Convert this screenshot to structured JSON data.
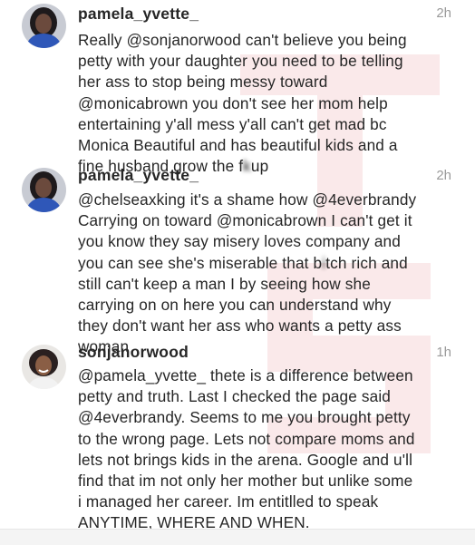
{
  "colors": {
    "text": "#262626",
    "timestamp": "#9a9a9a",
    "watermark": "#d8303a"
  },
  "watermark": {
    "text": "TSR"
  },
  "comments": [
    {
      "username": "pamela_yvette_",
      "time": "2h",
      "avatar": "avatar-photo-woman-blue-top",
      "lines": [
        "Really @sonjanorwood can't believe you being",
        "petty with your daughter you need to be telling",
        "her ass to stop being messy toward",
        "@monicabrown you don't see her mom help",
        "entertaining y'all mess y'all can't get mad bc",
        "Monica Beautiful and has beautiful kids and a",
        "fine husband grow the f",
        "k",
        "up"
      ]
    },
    {
      "username": "pamela_yvette_",
      "time": "2h",
      "avatar": "avatar-photo-woman-blue-top",
      "lines": [
        "@chelseaxking it's a shame how @4everbrandy",
        "Carrying on toward @monicabrown I can't get it",
        "you know they say misery loves company and",
        "you can see she's miserable that b",
        "tch rich and",
        "still can't keep a man I by seeing how she",
        "carrying on on here you can understand why",
        "they don't want her ass who wants a petty ass",
        "woman"
      ]
    },
    {
      "username": "sonjanorwood",
      "time": "1h",
      "avatar": "avatar-photo-woman-smiling",
      "lines": [
        "@pamela_yvette_ thete is a difference between",
        "petty and truth. Last I checked the page said",
        "@4everbrandy. Seems to me you brought petty",
        "to the wrong page. Lets not compare moms and",
        "lets not brings kids in the arena. Google and u'll",
        "find that im not only her mother but unlike some",
        "i managed her career. Im entitlled to speak",
        "ANYTIME, WHERE AND WHEN."
      ]
    }
  ]
}
